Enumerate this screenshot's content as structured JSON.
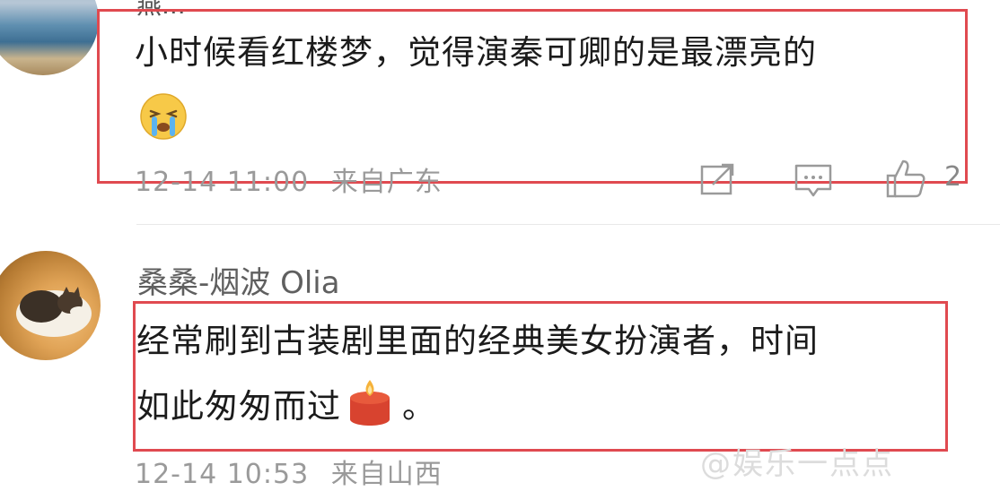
{
  "comment1": {
    "username": "燕...",
    "text": "小时候看红楼梦，觉得演秦可卿的是最漂亮的",
    "emoji_icon": "crying-face-icon",
    "time": "12-14 11:00",
    "location": "来自广东",
    "like_count": "2"
  },
  "comment2": {
    "username": "桑桑-烟波 Olia",
    "text_line1": "经常刷到古装剧里面的经典美女扮演者，时间",
    "text_line2a": "如此匆匆而过",
    "emoji_icon": "candle-icon",
    "text_line2b": "。",
    "time": "12-14 10:53",
    "location": "来自山西"
  },
  "icons": {
    "share": "share-icon",
    "reply": "comment-icon",
    "like": "thumbs-up-icon"
  },
  "colors": {
    "highlight": "#e04a50",
    "meta_text": "#9a9a9a",
    "username": "#5f5f5f"
  },
  "watermark": "@娱乐一点点"
}
